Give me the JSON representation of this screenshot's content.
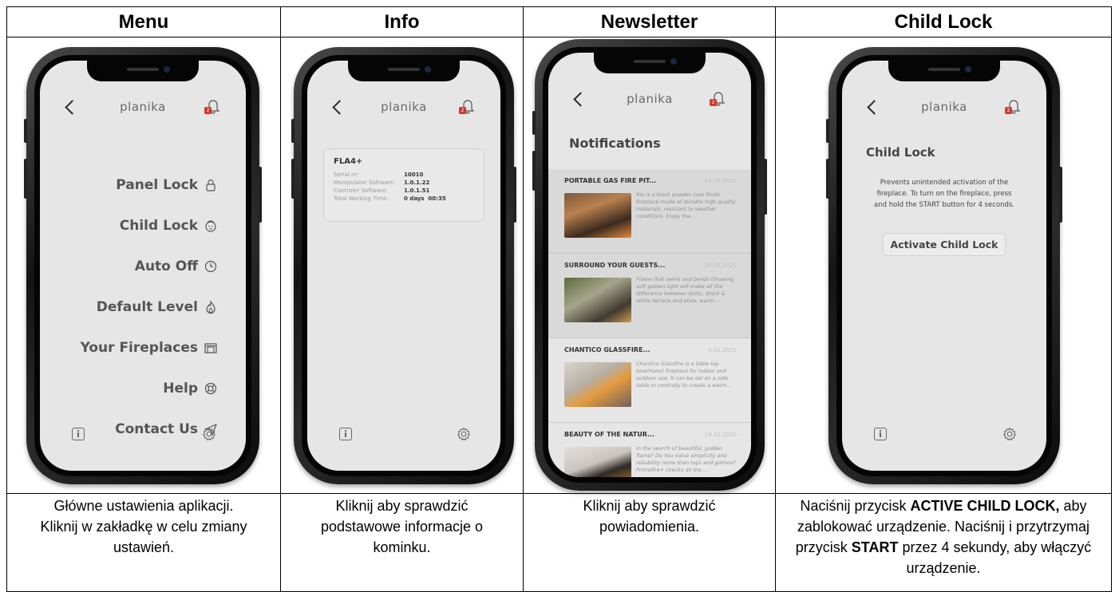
{
  "columns": [
    {
      "header": "Menu",
      "caption": [
        "Główne ustawienia aplikacji.",
        "Kliknij w zakładkę w celu zmiany",
        "ustawień."
      ]
    },
    {
      "header": "Info",
      "caption": [
        "Kliknij aby sprawdzić",
        "podstawowe informacje o",
        "kominku."
      ]
    },
    {
      "header": "Newsletter",
      "caption": [
        "Kliknij aby sprawdzić",
        "powiadomienia."
      ]
    },
    {
      "header": "Child Lock",
      "caption_parts": [
        {
          "text": "Naciśnij przycisk ",
          "bold": false
        },
        {
          "text": "ACTIVE CHILD LOCK,",
          "bold": true
        },
        {
          "text": " aby zablokować urządzenie. Naciśnij i przytrzymaj przycisk ",
          "bold": false
        },
        {
          "text": "START",
          "bold": true
        },
        {
          "text": " przez 4 sekundy, aby włączyć urządzenie.",
          "bold": false
        }
      ]
    }
  ],
  "app": {
    "brand": "planika",
    "badge_count": "2",
    "icons": {
      "back": "chevron-left-icon",
      "notifications": "bell-icon",
      "info": "info-icon",
      "settings": "gear-icon"
    }
  },
  "menu": {
    "items": [
      {
        "label": "Panel Lock",
        "icon": "lock-icon"
      },
      {
        "label": "Child Lock",
        "icon": "baby-icon"
      },
      {
        "label": "Auto Off",
        "icon": "clock-icon"
      },
      {
        "label": "Default Level",
        "icon": "flame-icon"
      },
      {
        "label": "Your Fireplaces",
        "icon": "fireplace-icon"
      },
      {
        "label": "Help",
        "icon": "lifebuoy-icon"
      },
      {
        "label": "Contact Us",
        "icon": "send-icon"
      }
    ]
  },
  "info": {
    "device": "FLA4+",
    "rows": [
      {
        "k": "Serial nr:",
        "v": "10010"
      },
      {
        "k": "Manipulator Software:",
        "v": "1.0.1.22"
      },
      {
        "k": "Controler Software:",
        "v": "1.0.1.51"
      },
      {
        "k": "Total Working Time:",
        "v": "0 days  00:35"
      }
    ]
  },
  "newsletter": {
    "title": "Notifications",
    "items": [
      {
        "title": "PORTABLE GAS FIRE PIT...",
        "date": "13.05.2021",
        "text": "Rio is a block powder coat finish fireplace made of durable high quality materials, resistant to weather conditions. Enjoy the...",
        "shaded": true
      },
      {
        "title": "SURROUND YOUR GUESTS...",
        "date": "20.03.2021",
        "text": "Flame that swirls and bends throwing soft golden light will make all the difference between static, black & white terrace and olive, warm...",
        "shaded": true
      },
      {
        "title": "CHANTICO GLASSFIRE...",
        "date": "4.01.2021",
        "text": "Chantico Glassfire is a table top bioethanol fireplace for indoor and outdoor use. It can be set on a side table or centrally to create a warm...",
        "shaded": false
      },
      {
        "title": "BEAUTY OF THE NATUR...",
        "date": "24.11.2020",
        "text": "In the search of beautiful, golden flame? Do You value simplicity and reliability more than toys and gizmos? Primefire+ checks all the ...",
        "shaded": false
      }
    ]
  },
  "childlock": {
    "title": "Child Lock",
    "description": "Prevents unintended activation of the fireplace. To turn on the fireplace, press and hold the START button for 4 seconds.",
    "button": "Activate Child Lock"
  }
}
